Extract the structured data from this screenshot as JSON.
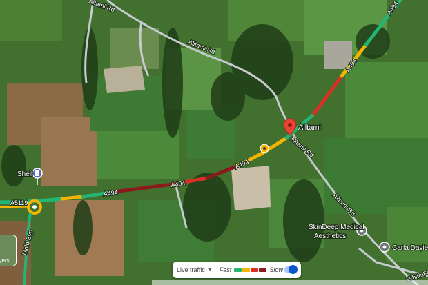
{
  "map": {
    "road_labels": {
      "a494_1": "A494",
      "a494_2": "A494",
      "a494_3": "A494",
      "a494_4": "A494",
      "a5119": "A5119",
      "mold_bypass": "Mold Byp",
      "alltami_rd_north": "Alltami Rd",
      "alltami_rd_top": "Altami Rd",
      "alltami_rd_east": "Alltami Rd",
      "alltami_rd_south": "Alltami Rd",
      "white_farm": "White Fa"
    },
    "places": {
      "alltami": "Alltami"
    },
    "pois": {
      "shell": "Shell",
      "skindeep_line1": "SkinDeep Medical",
      "skindeep_line2": "Aesthetics",
      "carla": "Carla Davies A"
    },
    "icons": {
      "location_pin": "location-pin-icon",
      "fuel": "fuel-station-icon",
      "camera": "speed-camera-icon",
      "poi": "place-marker-icon"
    },
    "colors": {
      "traffic_fast": "#22b573",
      "traffic_medium": "#f4b400",
      "traffic_slow": "#d93025",
      "traffic_very_slow": "#8b1a1a",
      "pin": "#ea4335"
    }
  },
  "traffic_panel": {
    "live_label": "Live traffic",
    "fast_label": "Fast",
    "slow_label": "Slow",
    "toggle_on": true
  },
  "layers_button": {
    "label": "ayers"
  }
}
